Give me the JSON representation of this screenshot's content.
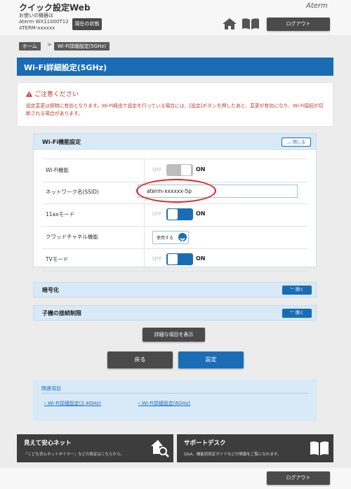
{
  "header": {
    "app_title": "クイック設定Web",
    "device_label": "お使いの機器は",
    "device_model": "Aterm WX11000T12",
    "device_ssid": "ATERM-xxxxxx",
    "status_button": "現在の状態",
    "brand": "Aterm",
    "logout": "ログアウト"
  },
  "breadcrumb": {
    "home": "ホーム",
    "separator": ">",
    "current": "Wi-Fi詳細設定(5GHz)"
  },
  "page_title": "Wi-Fi詳細設定(5GHz)",
  "caution": {
    "title": "ご注意ください",
    "body": "設定変更は即時に有効となります。Wi-Fi経由で設定を行っている場合には、[設定]ボタンを押したあと、変更が有効になり、Wi-Fi接続が切断される場合があります。"
  },
  "wifi_section": {
    "title": "Wi-Fi機能設定",
    "close_label": "閉じる",
    "rows": {
      "wifi": {
        "label": "Wi-Fi機能",
        "off": "OFF",
        "on": "ON",
        "state": false
      },
      "ssid": {
        "label": "ネットワーク名(SSID)",
        "value": "aterm-xxxxxx-5p"
      },
      "ax_mode": {
        "label": "11axモード",
        "off": "OFF",
        "on": "ON",
        "state": true
      },
      "crowd": {
        "label": "クワッドチャネル機能",
        "value": "使用する"
      },
      "tv_mode": {
        "label": "TVモード",
        "off": "OFF",
        "on": "ON",
        "state": true
      }
    }
  },
  "encryption": {
    "title": "暗号化",
    "open_label": "開く"
  },
  "client_limit": {
    "title": "子機の接続制限",
    "open_label": "開く"
  },
  "buttons": {
    "show_detail": "詳細な項目を表示",
    "back": "戻る",
    "set": "設定"
  },
  "related": {
    "title": "関連項目",
    "links": [
      "Wi-Fi詳細設定(2.4GHz)",
      "Wi-Fi詳細設定(6GHz)"
    ]
  },
  "banners": {
    "safe_net": {
      "title": "見えて安心ネット",
      "desc": "「こども安心ネットタイマー」などの設定はこちらから。"
    },
    "support": {
      "title": "サポートデスク",
      "desc": "Q&A、機能別設定ガイドなどの情報をご覧になれます。"
    }
  },
  "footer": {
    "logout": "ログアウト"
  },
  "colors": {
    "accent": "#1a6db5",
    "warning": "#c0392b",
    "annotation": "#e32222",
    "dark_button": "#4a4a4a"
  }
}
